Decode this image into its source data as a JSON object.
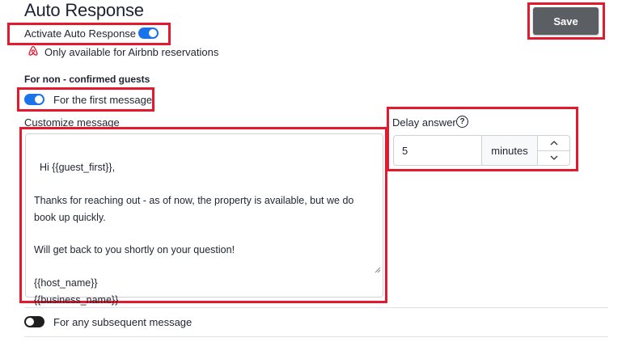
{
  "page": {
    "title": "Auto Response"
  },
  "toolbar": {
    "save_label": "Save"
  },
  "auto_response": {
    "label": "Activate Auto Response",
    "enabled": true,
    "note": "Only available for Airbnb reservations"
  },
  "non_confirmed": {
    "section_title": "For non - confirmed guests",
    "first_message": {
      "label": "For the first message",
      "enabled": true
    },
    "customize_label": "Customize message",
    "message": "Hi {{guest_first}},\n\nThanks for reaching out - as of now, the property is available, but we do book up quickly.\n\nWill get back to you shortly on your question!\n\n{{host_name}}\n{{business_name}}",
    "subsequent": {
      "label": "For any subsequent message",
      "enabled": false
    }
  },
  "delay": {
    "label": "Delay answer",
    "help_icon": "?",
    "value": "5",
    "unit": "minutes"
  },
  "colors": {
    "accent": "#1a73e8",
    "highlight": "#e3192e",
    "save_bg": "#5b5e63"
  }
}
